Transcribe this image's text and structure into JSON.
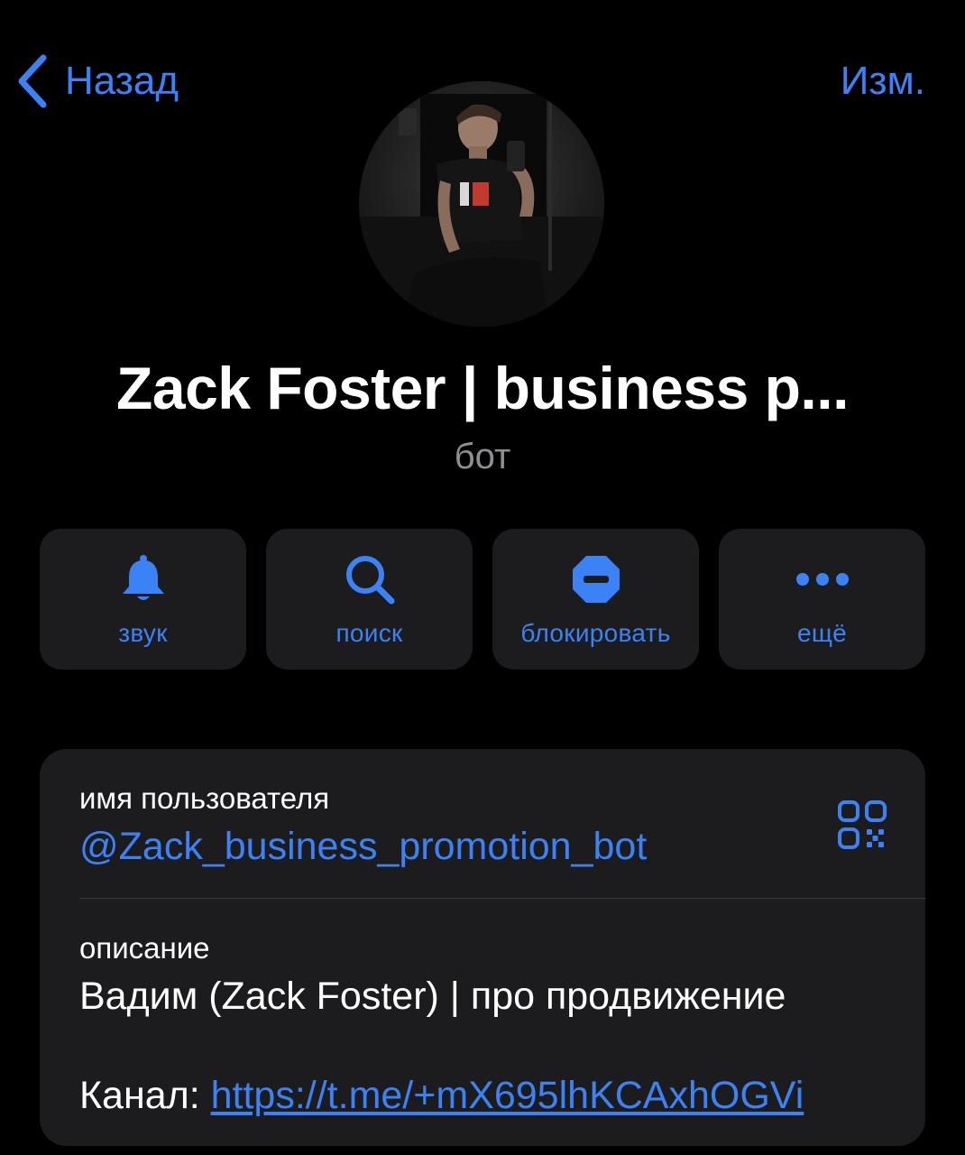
{
  "colors": {
    "accent": "#3b82f6",
    "background": "#000000",
    "card": "#1c1c1e",
    "secondary_text": "#8e8e93"
  },
  "nav": {
    "back_label": "Назад",
    "back_icon": "chevron-left-icon",
    "edit_label": "Изм."
  },
  "profile": {
    "name": "Zack Foster | business p...",
    "subtitle": "бот",
    "avatar": "profile-photo"
  },
  "actions": [
    {
      "icon": "bell-icon",
      "label": "звук"
    },
    {
      "icon": "search-icon",
      "label": "поиск"
    },
    {
      "icon": "block-icon",
      "label": "блокировать"
    },
    {
      "icon": "more-icon",
      "label": "ещё"
    }
  ],
  "info": {
    "username_label": "имя пользователя",
    "username": "@Zack_business_promotion_bot",
    "qr_icon": "qr-code-icon",
    "description_label": "описание",
    "description_line1": "Вадим (Zack Foster) | про продвижение",
    "channel_prefix": "Канал: ",
    "channel_link": "https://t.me/+mX695lhKCAxhOGVi"
  }
}
